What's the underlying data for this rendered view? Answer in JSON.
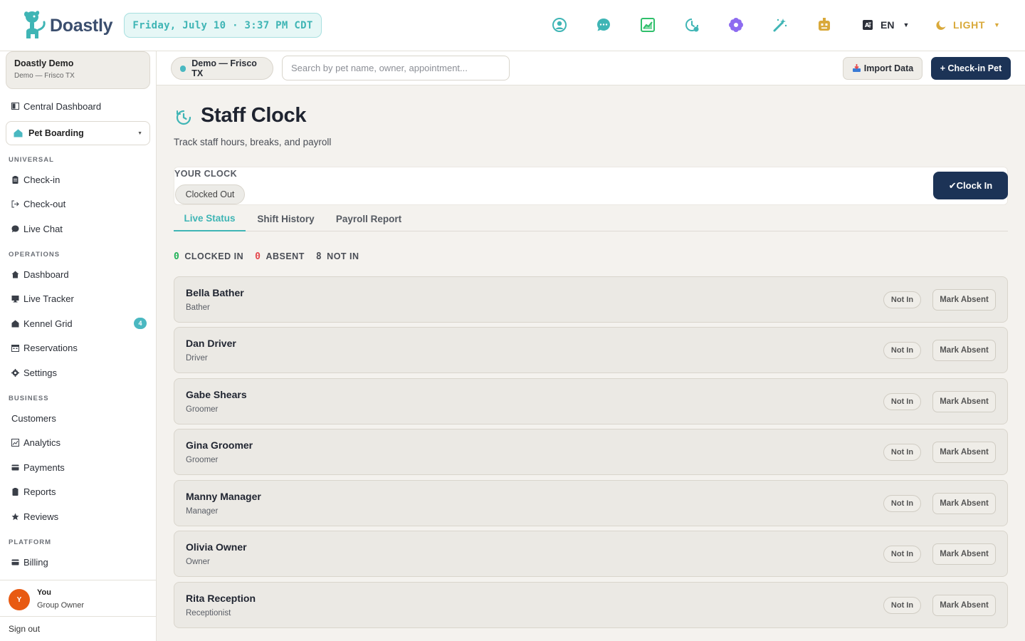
{
  "app": {
    "name": "Doastly"
  },
  "header": {
    "datetime": "Friday, July 10 · 3:37 PM CDT",
    "language": "EN",
    "theme": "LIGHT",
    "icons": [
      "user-circle-icon",
      "chat-icon",
      "chart-icon",
      "clock-icon",
      "flower-icon",
      "magic-wand-icon",
      "robot-icon"
    ]
  },
  "sidebar": {
    "org_name": "Doastly Demo",
    "org_location": "Demo — Frisco TX",
    "central_dashboard": "Central Dashboard",
    "module": "Pet Boarding",
    "sections": {
      "universal": "UNIVERSAL",
      "operations": "OPERATIONS",
      "business": "BUSINESS",
      "platform": "PLATFORM"
    },
    "universal_items": [
      "Check-in",
      "Check-out",
      "Live Chat"
    ],
    "operations_items": [
      "Dashboard",
      "Live Tracker",
      "Kennel Grid",
      "Reservations",
      "Settings"
    ],
    "kennel_badge": "4",
    "business_items": [
      "Customers",
      "Analytics",
      "Payments",
      "Reports",
      "Reviews"
    ],
    "platform_items": [
      "Billing"
    ],
    "user": {
      "initial": "Y",
      "name": "You",
      "role": "Group Owner"
    },
    "sign_out": "Sign out"
  },
  "subheader": {
    "location": "Demo — Frisco TX",
    "search_placeholder": "Search by pet name, owner, appointment...",
    "import_label": "Import Data",
    "checkin_label": "+ Check-in Pet"
  },
  "page": {
    "title": "Staff Clock",
    "subtitle": "Track staff hours, breaks, and payroll",
    "your_clock_label": "YOUR CLOCK",
    "clock_status": "Clocked Out",
    "clock_in_label": "✔Clock In",
    "tabs": [
      "Live Status",
      "Shift History",
      "Payroll Report"
    ],
    "counts": {
      "clocked_in": {
        "num": "0",
        "label": "CLOCKED IN"
      },
      "absent": {
        "num": "0",
        "label": "ABSENT"
      },
      "not_in": {
        "num": "8",
        "label": "NOT IN"
      }
    },
    "status_label": "Not In",
    "mark_absent_label": "Mark Absent",
    "staff": [
      {
        "name": "Bella Bather",
        "role": "Bather"
      },
      {
        "name": "Dan Driver",
        "role": "Driver"
      },
      {
        "name": "Gabe Shears",
        "role": "Groomer"
      },
      {
        "name": "Gina Groomer",
        "role": "Groomer"
      },
      {
        "name": "Manny Manager",
        "role": "Manager"
      },
      {
        "name": "Olivia Owner",
        "role": "Owner"
      },
      {
        "name": "Rita Reception",
        "role": "Receptionist"
      }
    ]
  },
  "colors": {
    "accent": "#3fb5b5",
    "primary": "#1c3356",
    "clocked_in": "#22b35a",
    "absent": "#e5484d",
    "theme": "#d9a93a"
  }
}
